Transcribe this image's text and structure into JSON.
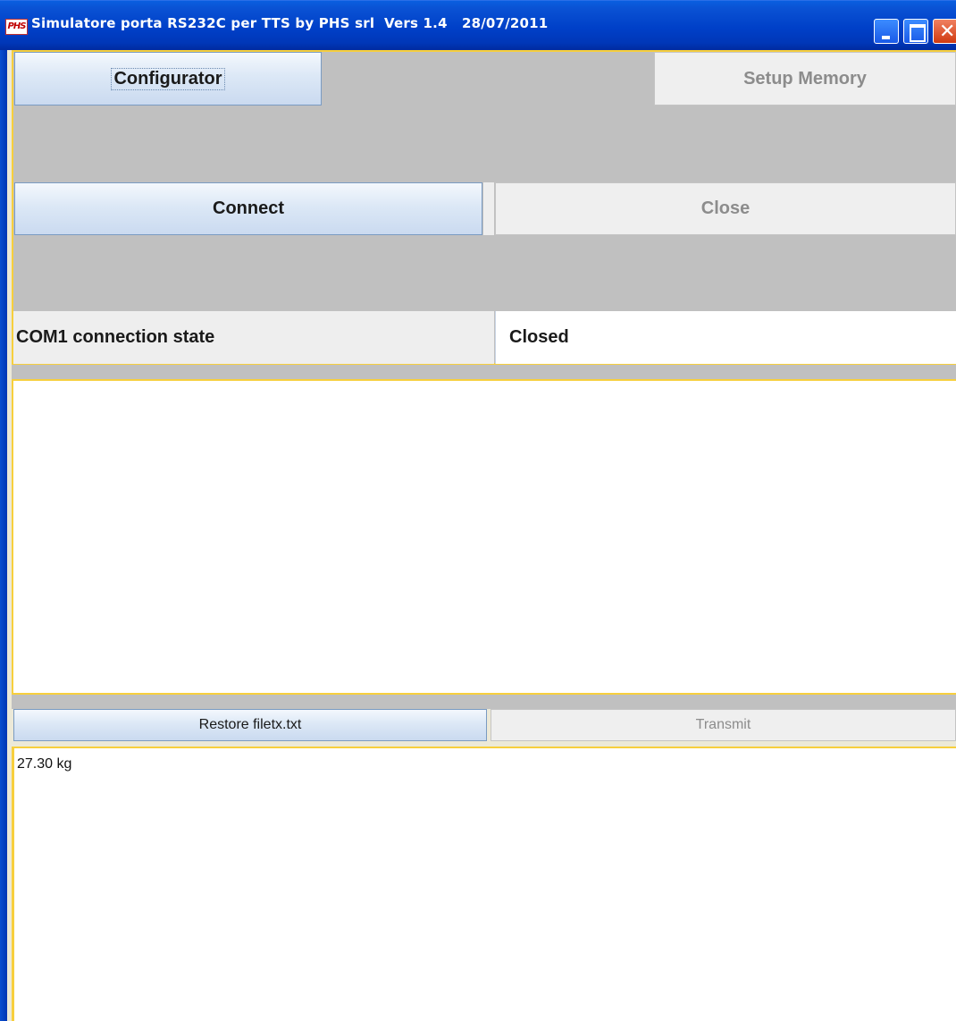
{
  "window": {
    "icon_text": "PHS",
    "title": "Simulatore porta RS232C per TTS by PHS srl  Vers 1.4   28/07/2011"
  },
  "toolbar": {
    "configurator_label": "Configurator",
    "setup_memory_label": "Setup Memory"
  },
  "connection": {
    "connect_label": "Connect",
    "close_label": "Close",
    "state_label": "COM1 connection state",
    "state_value": "Closed"
  },
  "log": {
    "content": ""
  },
  "transmit_panel": {
    "restore_label": "Restore filetx.txt",
    "transmit_label": "Transmit",
    "content": "27.30 kg"
  },
  "colors": {
    "titlebar": "#0a52d4",
    "panel_bg": "#c0c0c0",
    "focus_border": "#f7cf3d",
    "disabled_text": "#8c8c8c"
  }
}
